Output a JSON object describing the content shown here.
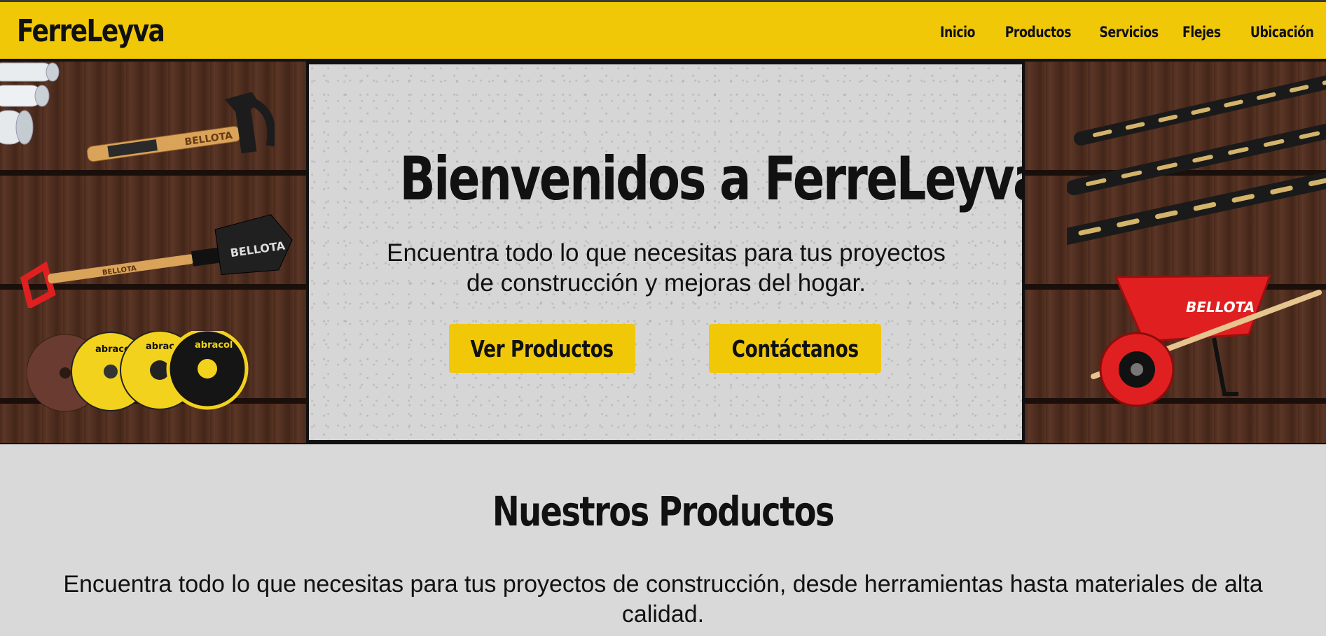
{
  "brand": "FerreLeyva",
  "nav": [
    "Inicio",
    "Productos",
    "Servicios",
    "Flejes",
    "Ubicación"
  ],
  "hero": {
    "title": "Bienvenidos a FerreLeyva",
    "subtitle": "Encuentra todo lo que necesitas para tus proyectos de construcción y mejoras del hogar.",
    "btn_products": "Ver Productos",
    "btn_contact": "Contáctanos"
  },
  "products": {
    "title": "Nuestros Productos",
    "description": "Encuentra todo lo que necesitas para tus proyectos de construcción, desde herramientas hasta materiales de alta calidad."
  },
  "tool_brands": {
    "hammer": "BELLOTA",
    "shovel": "BELLOTA",
    "wheelbarrow": "BELLOTA",
    "discs": "abracol"
  },
  "colors": {
    "accent": "#f0c808",
    "text": "#111111",
    "section_bg": "#d9d9d9",
    "wood": "#4f2e20",
    "tool_red": "#e02020"
  },
  "icons": [
    "pvc-pipes-icon",
    "hammer-icon",
    "shovel-icon",
    "cutting-discs-icon",
    "drill-bits-icon",
    "wheelbarrow-icon"
  ]
}
